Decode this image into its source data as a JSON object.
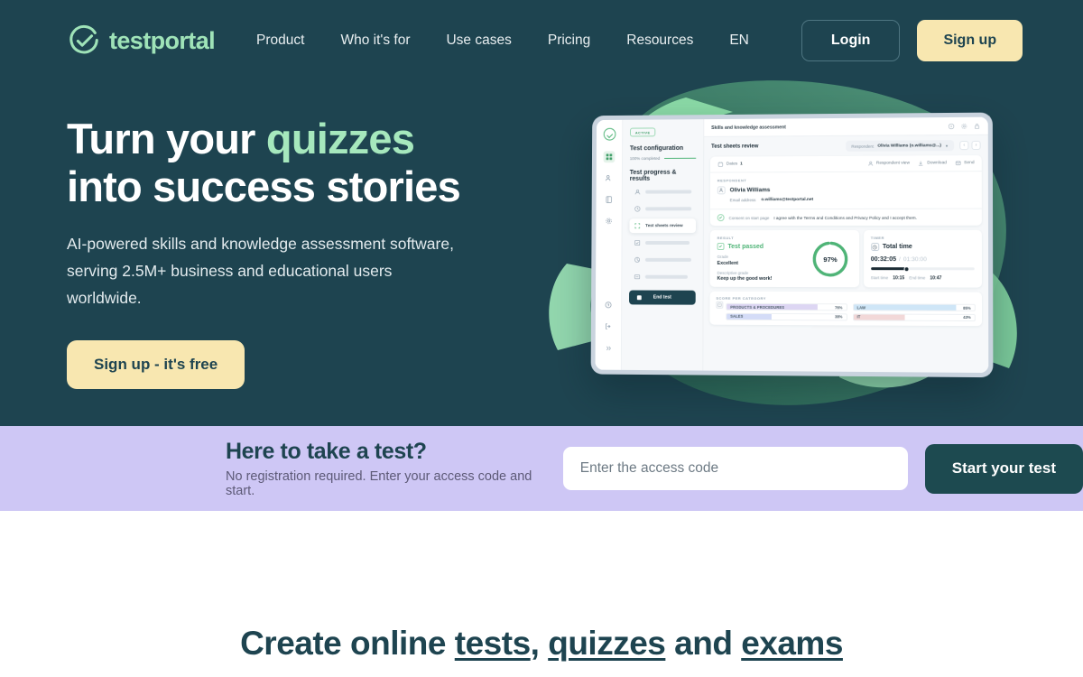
{
  "brand": {
    "name": "testportal",
    "logo_icon": "circle-check-logo-icon",
    "accent_green": "#a6e8bd",
    "dark_teal": "#1e4450",
    "cream": "#f8e7b0",
    "purple": "#cec7f5"
  },
  "nav": {
    "links": [
      {
        "label": "Product"
      },
      {
        "label": "Who it's for"
      },
      {
        "label": "Use cases"
      },
      {
        "label": "Pricing"
      },
      {
        "label": "Resources"
      },
      {
        "label": "EN"
      }
    ],
    "login_label": "Login",
    "signup_label": "Sign up"
  },
  "hero": {
    "title_part1": "Turn your ",
    "title_accent": "quizzes",
    "title_part2": "into success stories",
    "subtitle": "AI-powered skills and knowledge assessment software, serving 2.5M+ business and educational users worldwide.",
    "cta_label": "Sign up - it's free"
  },
  "mockup": {
    "topbar": {
      "title": "Skills and knowledge assessment",
      "icons": [
        "help-circle-icon",
        "settings-gear-icon",
        "lock-icon"
      ]
    },
    "sidebar": {
      "status_badge": "ACTIVE",
      "config_heading": "Test configuration",
      "progress_label": "100% completed",
      "results_heading": "Test progress & results",
      "selected_item": "Test sheets review",
      "end_test_label": "End test"
    },
    "subbar": {
      "title": "Test sheets review",
      "respondent_label": "Respondent",
      "respondent_value": "Olivia Williams (o.williams@...)"
    },
    "toolbar": {
      "dates_label": "Dates",
      "dates_value": "1",
      "respondent_view": "Respondent view",
      "download": "Download",
      "send": "Send"
    },
    "respondent": {
      "section_label": "RESPONDENT",
      "name": "Olivia Williams",
      "email_label": "Email address",
      "email_value": "o.williams@testportal.net",
      "consent_label": "Consent on start page",
      "consent_text": "I agree with the Terms and Conditions and Privacy Policy and I accept them."
    },
    "result": {
      "section_label": "RESULT",
      "status": "Test passed",
      "grade_label": "Grade",
      "grade_value": "Excellent",
      "descriptive_label": "Descriptive grade",
      "descriptive_value": "Keep up the good work!",
      "score_pct": "97%"
    },
    "timer": {
      "section_label": "TIMER",
      "heading": "Total time",
      "current": "00:32:05",
      "separator": "/",
      "maximum": "01:30:00",
      "start_label": "Start time",
      "start_value": "10:15",
      "end_label": "End time",
      "end_value": "10:47"
    },
    "categories": {
      "section_label": "SCORE PER CATEGORY",
      "items": [
        {
          "name": "PRODUCTS & PROCEDURES",
          "pct": "76%",
          "fill": 76,
          "color": "#ddd6f3"
        },
        {
          "name": "SALES",
          "pct": "38%",
          "fill": 38,
          "color": "#d4dcf7"
        },
        {
          "name": "LAW",
          "pct": "85%",
          "fill": 85,
          "color": "#cfe6f7"
        },
        {
          "name": "IT",
          "pct": "43%",
          "fill": 43,
          "color": "#f2d8d8"
        }
      ]
    }
  },
  "band": {
    "title": "Here to take a test?",
    "subtitle": "No registration required. Enter your access code and start.",
    "input_placeholder": "Enter the access code",
    "input_value": "",
    "start_label": "Start your test"
  },
  "below": {
    "title_p1": "Create online ",
    "link1": "tests",
    "title_p2": ", ",
    "link2": "quizzes",
    "title_p3": " and ",
    "link3": "exams"
  }
}
